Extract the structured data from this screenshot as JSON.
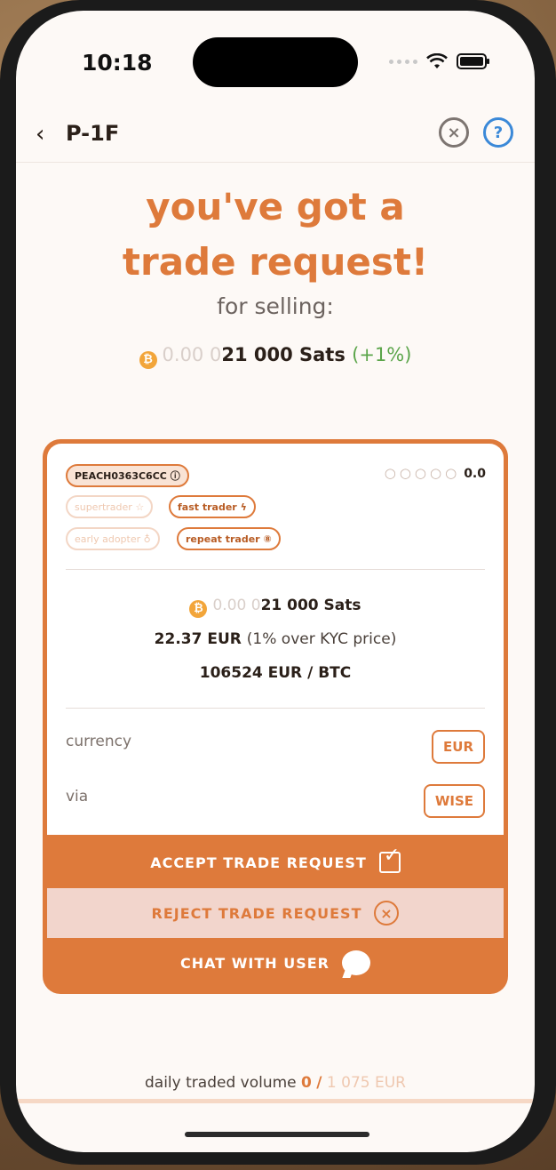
{
  "status": {
    "time": "10:18"
  },
  "header": {
    "back_icon": "chevron-left-icon",
    "title": "P-1F",
    "close_icon": "close-circle-icon",
    "help_icon": "help-circle-icon"
  },
  "main": {
    "headline_line1": "you've got a",
    "headline_line2": "trade request!",
    "subtitle": "for selling:",
    "amount_prefix": "0.00 0",
    "amount_main": "21 000 Sats",
    "premium": "(+1%)"
  },
  "card": {
    "user_id": "PEACH0363C6CC",
    "rating": "0.0",
    "badges": [
      {
        "label": "supertrader",
        "icon": "star-icon",
        "active": false
      },
      {
        "label": "fast trader",
        "icon": "lightning-icon",
        "active": true
      },
      {
        "label": "early adopter",
        "icon": "award-icon",
        "active": false
      },
      {
        "label": "repeat trader",
        "icon": "repeat-icon",
        "active": true
      }
    ],
    "amount_prefix": "0.00 0",
    "amount_main": "21 000 Sats",
    "fiat_amount": "22.37 EUR",
    "fiat_note": "(1% over KYC price)",
    "price_per_btc": "106524 EUR / BTC",
    "currency_label": "currency",
    "currency_value": "EUR",
    "via_label": "via",
    "via_value": "WISE",
    "accept_label": "ACCEPT TRADE REQUEST",
    "reject_label": "REJECT TRADE REQUEST",
    "chat_label": "CHAT WITH USER"
  },
  "footer": {
    "label": "daily traded volume",
    "current": "0",
    "separator": "/",
    "max": "1 075 EUR",
    "progress": 0
  },
  "colors": {
    "accent": "#de7a3b",
    "help": "#3b89d8",
    "positive": "#5ba54a"
  }
}
